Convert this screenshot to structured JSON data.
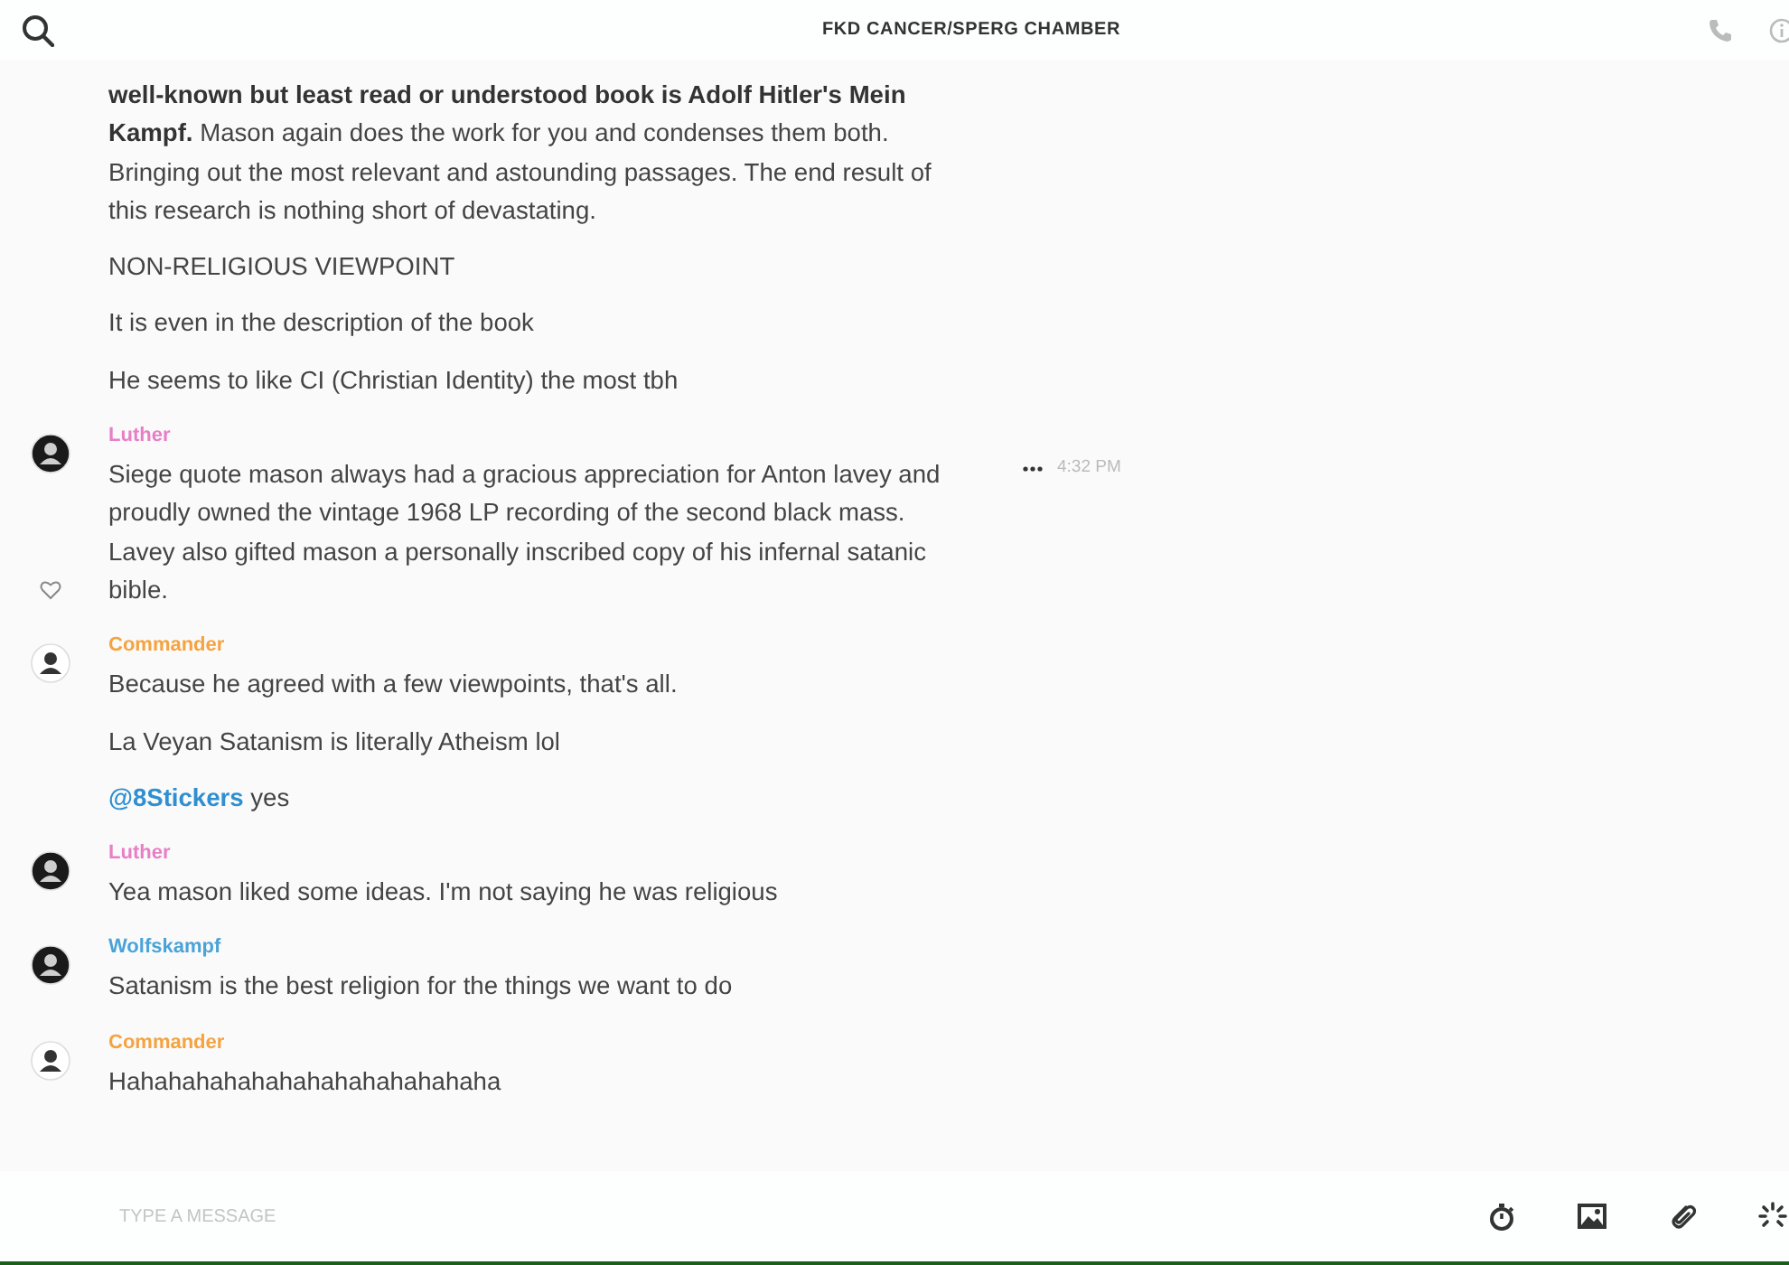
{
  "header": {
    "title": "FKD CANCER/SPERG CHAMBER"
  },
  "messages": [
    {
      "paragraphs": [
        {
          "text": "**well-known but least read or understood book is Adolf Hitler's Mein Kampf.** Mason again does the work for you and condenses them both. Bringing out the most relevant and astounding passages. The end result of this research is nothing short of devastating."
        },
        {
          "text": "NON-RELIGIOUS VIEWPOINT"
        },
        {
          "text": "It is even in the description of the book"
        },
        {
          "text": "He seems to like CI (Christian Identity) the most tbh"
        }
      ]
    },
    {
      "author": "Luther",
      "color": "#e87fc6",
      "avatar": {
        "kind": "dark"
      },
      "time": "4:32 PM",
      "hovered": true,
      "paragraphs": [
        {
          "text": "Siege quote mason always had a gracious appreciation for Anton lavey and proudly owned the vintage 1968 LP recording of the second black mass. Lavey also gifted mason a personally inscribed copy of his infernal satanic bible."
        }
      ]
    },
    {
      "author": "Commander",
      "color": "#f5a340",
      "avatar": {
        "kind": "light"
      },
      "paragraphs": [
        {
          "text": "Because he agreed with a few viewpoints, that's all."
        },
        {
          "text": "La Veyan Satanism is literally Atheism lol"
        },
        {
          "mention": "@8Stickers",
          "text": "yes"
        }
      ]
    },
    {
      "author": "Luther",
      "color": "#e87fc6",
      "avatar": {
        "kind": "dark"
      },
      "paragraphs": [
        {
          "text": "Yea mason liked some ideas. I'm not saying he was religious"
        }
      ]
    },
    {
      "author": "Wolfskampf",
      "color": "#4aa3d8",
      "avatar": {
        "kind": "dark"
      },
      "paragraphs": [
        {
          "text": "Satanism is the best religion for the things we want to do"
        }
      ]
    },
    {
      "author": "Commander",
      "color": "#f5a340",
      "avatar": {
        "kind": "light"
      },
      "paragraphs": [
        {
          "text": "Hahahahahahahahahahahahahaha"
        }
      ]
    }
  ],
  "composer": {
    "placeholder": "TYPE A MESSAGE"
  }
}
